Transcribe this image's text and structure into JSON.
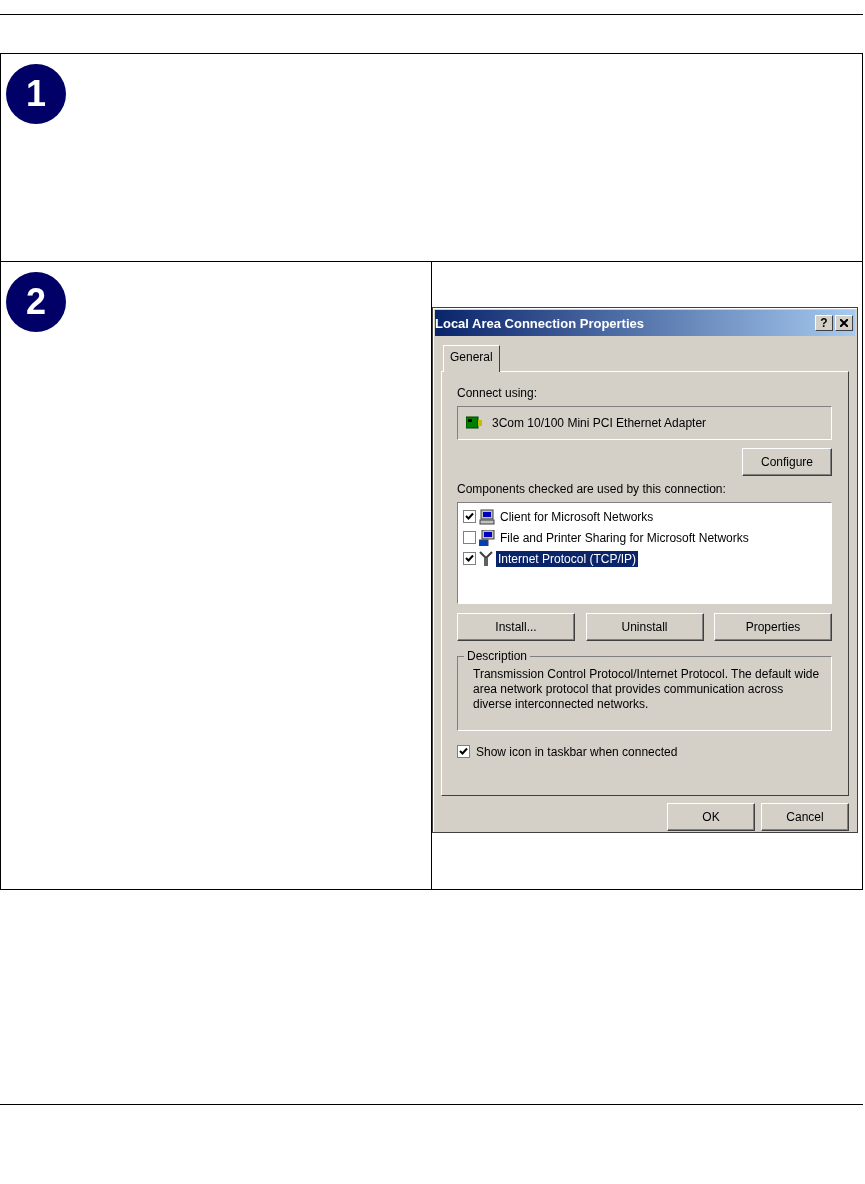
{
  "steps": [
    {
      "number": "1"
    },
    {
      "number": "2"
    }
  ],
  "dialog": {
    "title": "Local Area Connection Properties",
    "help_button": "?",
    "tabs": [
      {
        "label": "General",
        "selected": true
      }
    ],
    "connect_using_label": "Connect using:",
    "adapter": "3Com 10/100 Mini PCI Ethernet Adapter",
    "configure_button": "Configure",
    "components_label": "Components checked are used by this connection:",
    "components": [
      {
        "kind": "client",
        "label": "Client for Microsoft Networks",
        "checked": true,
        "selected": false
      },
      {
        "kind": "service",
        "label": "File and Printer Sharing for Microsoft Networks",
        "checked": false,
        "selected": false
      },
      {
        "kind": "protocol",
        "label": "Internet Protocol (TCP/IP)",
        "checked": true,
        "selected": true
      }
    ],
    "component_buttons": [
      "Install...",
      "Uninstall",
      "Properties"
    ],
    "description": {
      "legend": "Description",
      "text": "Transmission Control Protocol/Internet Protocol. The default wide area network protocol that provides communication across diverse interconnected networks."
    },
    "show_icon": {
      "label": "Show icon in taskbar when connected",
      "checked": true
    },
    "footer_buttons": [
      "OK",
      "Cancel"
    ]
  }
}
